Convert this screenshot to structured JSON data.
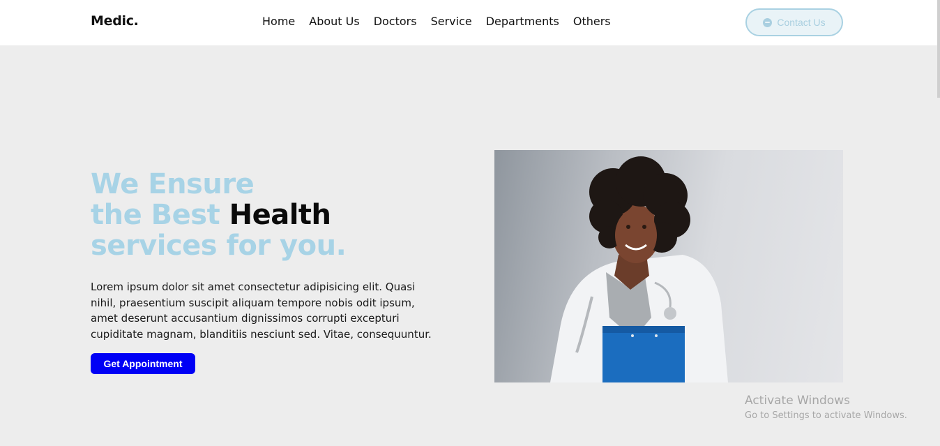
{
  "brand": {
    "logo": "Medic."
  },
  "nav": {
    "items": [
      {
        "label": "Home"
      },
      {
        "label": "About Us"
      },
      {
        "label": "Doctors"
      },
      {
        "label": "Service"
      },
      {
        "label": "Departments"
      },
      {
        "label": "Others"
      }
    ],
    "contact_label": "Contact Us",
    "contact_icon": "chat-icon"
  },
  "hero": {
    "title_line1": "We Ensure",
    "title_line2_light": "the Best ",
    "title_line2_dark": "Health",
    "title_line3": "services for you.",
    "description": "Lorem ipsum dolor sit amet consectetur adipisicing elit. Quasi nihil, praesentium suscipit aliquam tempore nobis odit ipsum, amet deserunt accusantium dignissimos corrupti excepturi cupiditate magnam, blanditiis nesciunt sed. Vitae, consequuntur.",
    "cta_label": "Get Appointment",
    "image": "doctor-photo"
  },
  "watermark": {
    "title": "Activate Windows",
    "subtitle": "Go to Settings to activate Windows."
  },
  "colors": {
    "accent_light_blue": "#a7d3e6",
    "cta_blue": "#0000f5",
    "background": "#ededed"
  }
}
